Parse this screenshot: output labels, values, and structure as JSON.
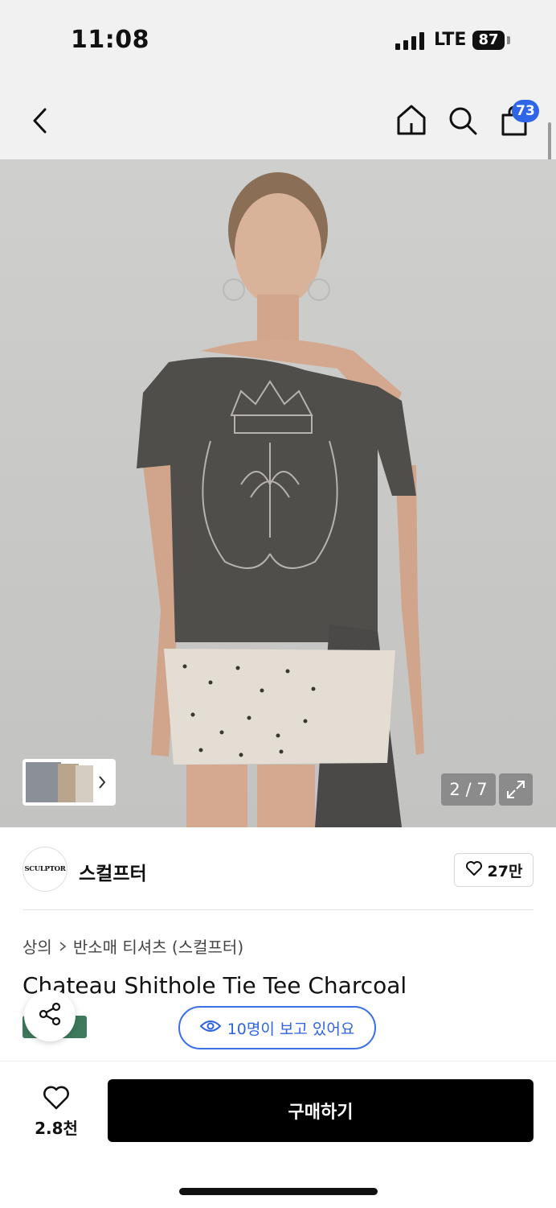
{
  "status_bar": {
    "time": "11:08",
    "network": "LTE",
    "battery": "87"
  },
  "header": {
    "cart_count": "73",
    "icons": [
      "back-icon",
      "home-icon",
      "search-icon",
      "shopping-bag-icon"
    ]
  },
  "gallery": {
    "counter": "2 / 7"
  },
  "brand": {
    "logo_text": "SCULPTOR",
    "name": "스컬프터",
    "likes": "27만"
  },
  "product": {
    "breadcrumb": [
      "상의",
      "반소매 티셔츠 (스컬프터)"
    ],
    "title": "Chateau Shithole Tie Tee Charcoal",
    "viewers": "10명이 보고 있어요"
  },
  "bottom_bar": {
    "wish_count": "2.8천",
    "buy_label": "구매하기"
  },
  "colors": {
    "accent_blue": "#2f66e8",
    "buy_button": "#000000",
    "tag_green": "#3f7a5c"
  }
}
